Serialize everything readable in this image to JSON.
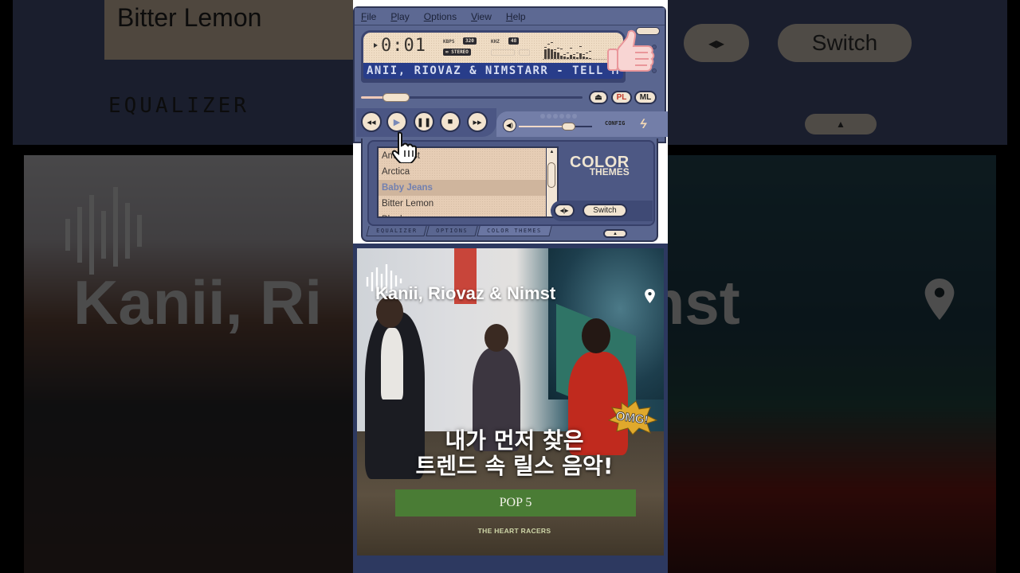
{
  "player": {
    "menu": [
      "File",
      "Play",
      "Options",
      "View",
      "Help"
    ],
    "time": "0:01",
    "kbps_label": "KBPS",
    "kbps_value": "320",
    "khz_label": "KHZ",
    "khz_value": "48",
    "stereo_label": "STEREO",
    "marquee_text": "ANII, RIOVAZ & NIMSTARR - TELL M",
    "seek_progress": 0.12,
    "volume_level": 0.72,
    "visualizer_levels": [
      0.75,
      0.85,
      0.75,
      0.6,
      0.5,
      0.25,
      0.2,
      0.1,
      0.35,
      0.2,
      0.15,
      0.45,
      0.2,
      0.1,
      0.05
    ],
    "buttons": {
      "eject": "eject",
      "pl": "PL",
      "ml": "ML",
      "config": "CONFIG"
    },
    "transport": [
      "previous",
      "play",
      "pause",
      "stop",
      "next"
    ]
  },
  "themes_panel": {
    "logo_line1": "COLOR",
    "logo_line2": "THEMES",
    "items": [
      "Amethyst",
      "Arctica",
      "Baby Jeans",
      "Bitter Lemon",
      "Blueberry"
    ],
    "selected_index": 2,
    "switch_label": "Switch",
    "tabs": [
      "EQUALIZER",
      "OPTIONS",
      "COLOR THEMES"
    ],
    "active_tab": 2
  },
  "video": {
    "artist": "Kanii, Riovaz & Nimst",
    "title_line1": "내가 먼저 찾은",
    "title_line2": "트렌드 속 릴스 음악!",
    "sticker": "OMG!",
    "banner": "POP 5",
    "album_caption": "THE HEART RACERS"
  },
  "background": {
    "left_list_item": "Bitter Lemon",
    "left_tab": "EQUALIZER",
    "right_switch": "Switch",
    "left_text": "Kanii, Ri",
    "right_text": "mst"
  },
  "colors": {
    "skin_blue": "#5a6690",
    "lcd_cream": "#efdcc4",
    "marquee_blue": "#283d8a",
    "banner_green": "#4a7c35"
  }
}
